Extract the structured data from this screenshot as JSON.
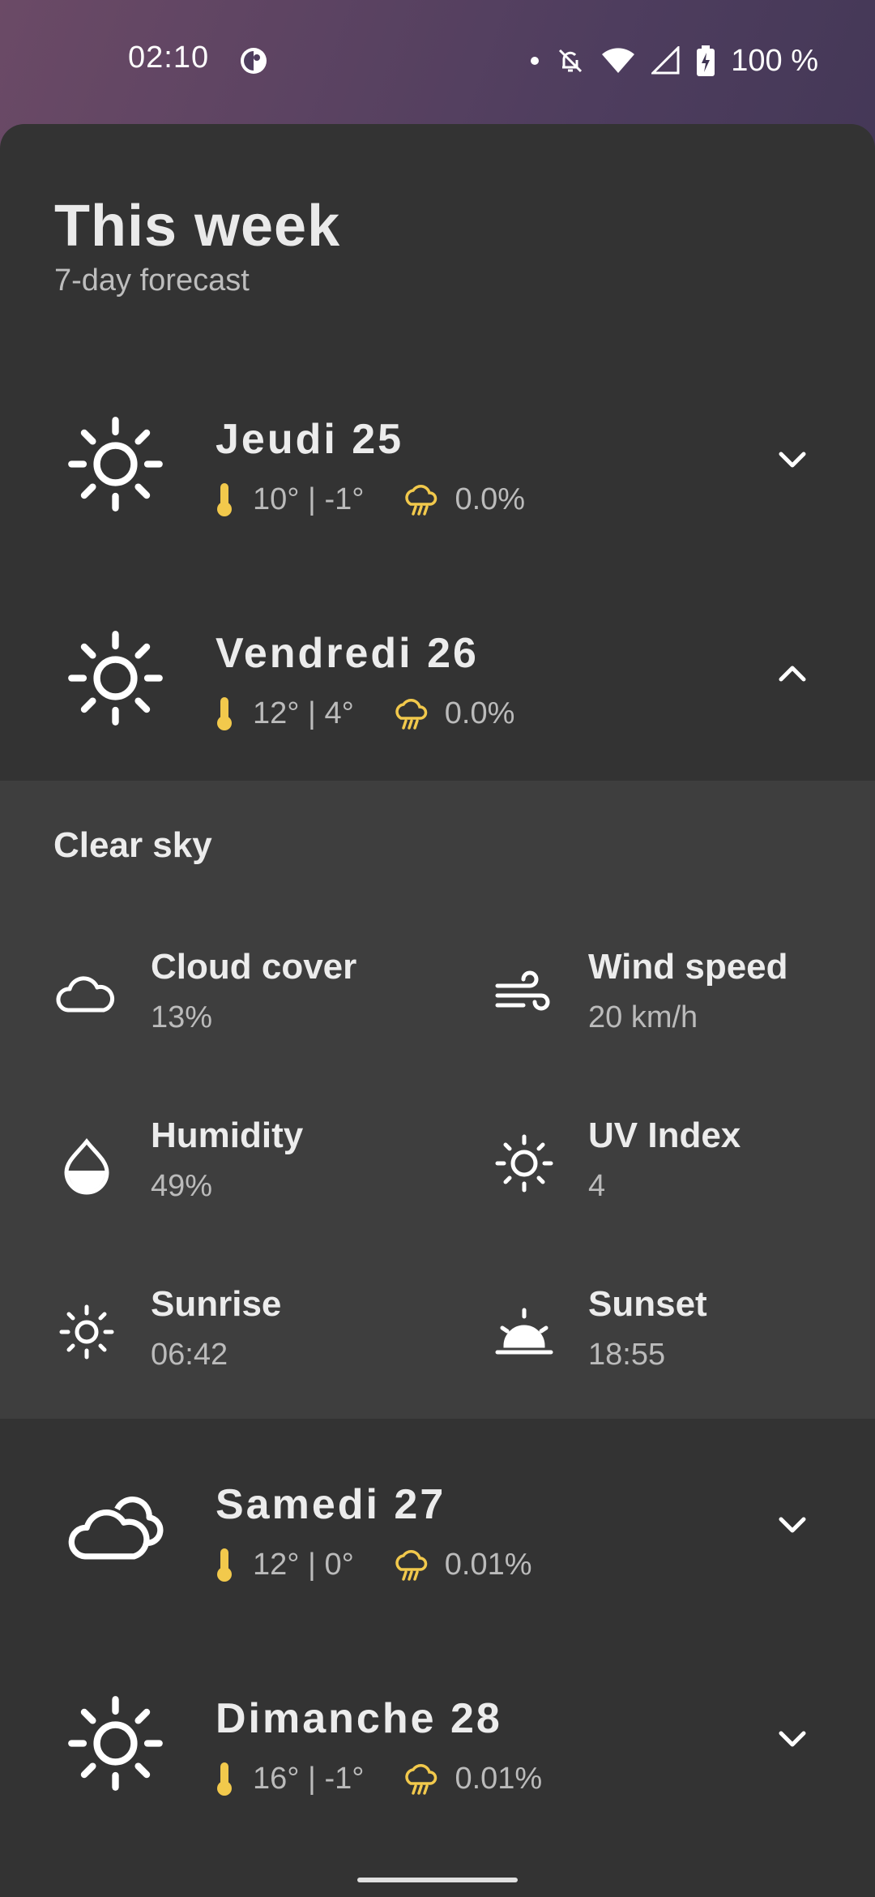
{
  "status_bar": {
    "time": "02:10",
    "battery": "100 %",
    "icons": [
      "app-status-icon",
      "notification-dot-icon",
      "bell-off-icon",
      "wifi-icon",
      "signal-icon",
      "battery-charging-icon"
    ]
  },
  "header": {
    "title": "This week",
    "subtitle": "7-day forecast"
  },
  "days": [
    {
      "name": "Jeudi 25",
      "temps": "10°  |  -1°",
      "precip": "0.0%",
      "icon": "sun-icon",
      "expanded": false
    },
    {
      "name": "Vendredi 26",
      "temps": "12°  |  4°",
      "precip": "0.0%",
      "icon": "sun-icon",
      "expanded": true
    },
    {
      "name": "Samedi 27",
      "temps": "12°  |  0°",
      "precip": "0.01%",
      "icon": "cloud-icon",
      "expanded": false
    },
    {
      "name": "Dimanche 28",
      "temps": "16°  |  -1°",
      "precip": "0.01%",
      "icon": "sun-icon",
      "expanded": false
    }
  ],
  "details": {
    "condition": "Clear sky",
    "items": [
      {
        "label": "Cloud cover",
        "value": "13%",
        "icon": "cloud-outline-icon"
      },
      {
        "label": "Wind speed",
        "value": "20 km/h",
        "icon": "wind-icon"
      },
      {
        "label": "Humidity",
        "value": "49%",
        "icon": "humidity-drop-icon"
      },
      {
        "label": "UV Index",
        "value": "4",
        "icon": "uv-sun-icon"
      },
      {
        "label": "Sunrise",
        "value": "06:42",
        "icon": "sunrise-icon"
      },
      {
        "label": "Sunset",
        "value": "18:55",
        "icon": "sunset-icon"
      }
    ]
  },
  "colors": {
    "sheet_background": "#333333",
    "details_background": "#3e3e3e",
    "accent_yellow": "#f2c94c",
    "text_primary": "#ececec",
    "text_secondary": "#bbbbbb"
  }
}
